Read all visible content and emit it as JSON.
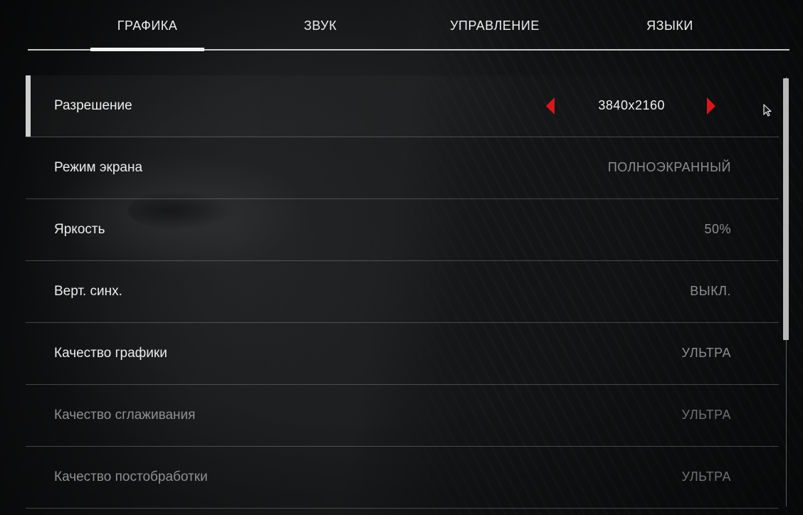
{
  "tabs": [
    {
      "label": "ГРАФИКА",
      "active": true
    },
    {
      "label": "ЗВУК",
      "active": false
    },
    {
      "label": "УПРАВЛЕНИЕ",
      "active": false
    },
    {
      "label": "ЯЗЫКИ",
      "active": false
    }
  ],
  "settings": [
    {
      "label": "Разрешение",
      "value": "3840x2160",
      "selected": true,
      "disabled": false
    },
    {
      "label": "Режим экрана",
      "value": "ПОЛНОЭКРАННЫЙ",
      "selected": false,
      "disabled": false
    },
    {
      "label": "Яркость",
      "value": "50%",
      "selected": false,
      "disabled": false
    },
    {
      "label": "Верт. синх.",
      "value": "ВЫКЛ.",
      "selected": false,
      "disabled": false
    },
    {
      "label": "Качество графики",
      "value": "УЛЬТРА",
      "selected": false,
      "disabled": false
    },
    {
      "label": "Качество сглаживания",
      "value": "УЛЬТРА",
      "selected": false,
      "disabled": true
    },
    {
      "label": "Качество постобработки",
      "value": "УЛЬТРА",
      "selected": false,
      "disabled": true
    }
  ],
  "icons": {
    "prev": "arrow-left-icon",
    "next": "arrow-right-icon",
    "cursor": "mouse-cursor-icon"
  },
  "colors": {
    "accent_arrow": "#d8171d",
    "active_tab_underline": "#f2f2f2",
    "scrollbar_thumb": "#b9b9b9"
  },
  "scroll": {
    "visible_fraction": 0.61
  }
}
